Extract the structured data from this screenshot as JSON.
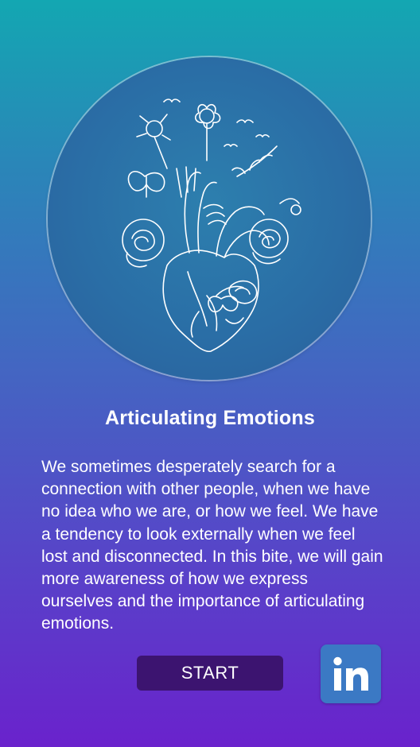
{
  "card": {
    "title": "Articulating Emotions",
    "description": "We sometimes desperately search for a connection with other people, when we have no idea who we are, or how we feel. We have a tendency to look externally when we feel lost and disconnected. In this bite, we will gain more awareness of how we express ourselves and the importance of articulating emotions.",
    "illustration_icon": "floral-anatomical-heart-illustration"
  },
  "actions": {
    "start_label": "START",
    "share_icon": "linkedin-icon"
  },
  "colors": {
    "gradient_top": "#13a7b2",
    "gradient_bottom": "#6a22cc",
    "button_bg": "#3c1470",
    "linkedin_bg": "#3b79c4"
  }
}
